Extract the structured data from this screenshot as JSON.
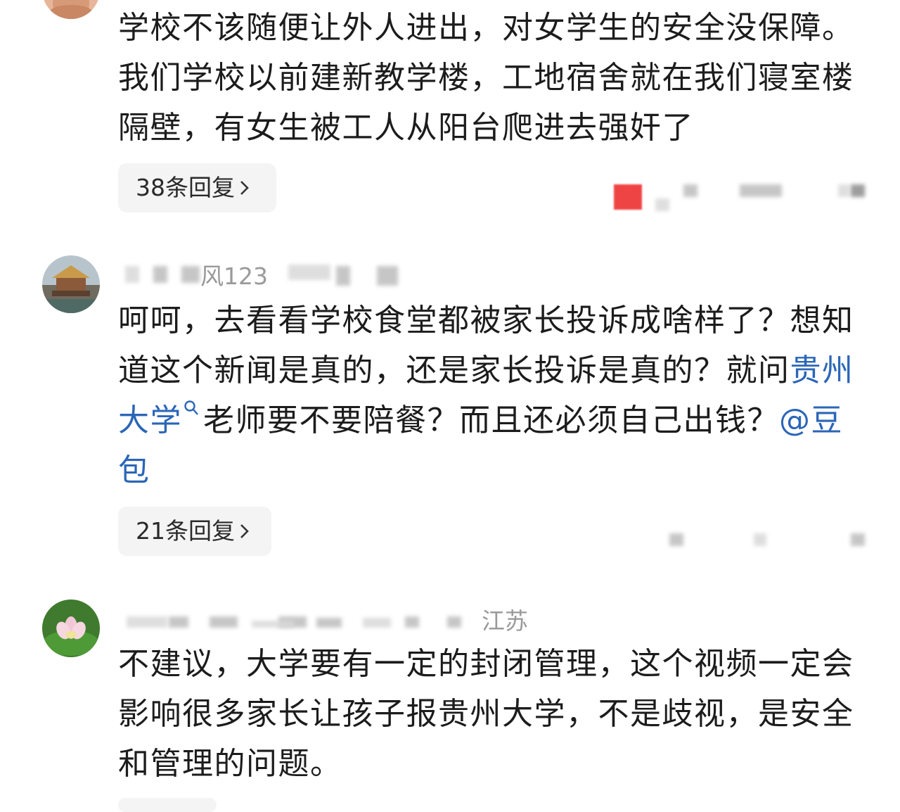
{
  "comments": [
    {
      "body": "学校不该随便让外人进出，对女学生的安全没保障。我们学校以前建新教学楼，工地宿舍就在我们寝室楼隔壁，有女生被工人从阳台爬进去强奸了",
      "reply_label": "38条回复"
    },
    {
      "username_visible": "风123",
      "body_parts": {
        "p1": "呵呵，去看看学校食堂都被家长投诉成啥样了？想知道这个新闻是真的，还是家长投诉是真的？就问",
        "link": "贵州大学",
        "p2": "老师要不要陪餐？而且还必须自己出钱？",
        "mention": "@豆包"
      },
      "reply_label": "21条回复"
    },
    {
      "location": "江苏",
      "body": "不建议，大学要有一定的封闭管理，这个视频一定会影响很多家长让孩子报贵州大学，不是歧视，是安全和管理的问题。"
    }
  ],
  "icons": {
    "search": "search-icon",
    "chevron": "chevron-right-icon"
  },
  "colors": {
    "link": "#2b66b8",
    "reply_bg": "#f4f4f4",
    "meta_text": "#9a9a9a"
  }
}
